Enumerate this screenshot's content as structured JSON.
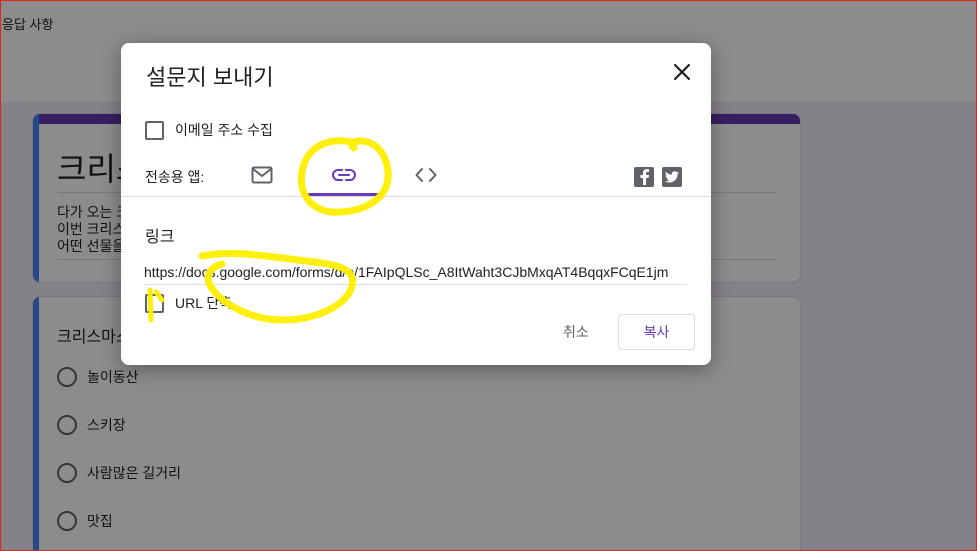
{
  "background": {
    "top_tab": "응답 사항",
    "form_title": "크리스마스",
    "description_lines": [
      "다가 오는 크리스마스",
      "이번 크리스마스에는",
      "어떤 선물을"
    ],
    "question_title": "크리스마스에",
    "options": [
      "놀이동산",
      "스키장",
      "사람많은 길거리",
      "맛집"
    ]
  },
  "dialog": {
    "title": "설문지 보내기",
    "collect_email_label": "이메일 주소 수집",
    "collect_email_checked": false,
    "send_via_label": "전송용 앱:",
    "tabs": [
      {
        "icon": "mail-icon",
        "active": false
      },
      {
        "icon": "link-icon",
        "active": true
      },
      {
        "icon": "embed-code-icon",
        "active": false
      }
    ],
    "social": [
      "facebook-icon",
      "twitter-icon"
    ],
    "link_section_label": "링크",
    "link_url": "https://docs.google.com/forms/d/e/1FAIpQLSc_A8ItWaht3CJbMxqAT4BqqxFCqE1jm",
    "shorten_label": "URL 단축",
    "shorten_checked": false,
    "cancel_label": "취소",
    "copy_label": "복사"
  },
  "colors": {
    "accent": "#673ab7",
    "annotation": "#ffee00",
    "frame": "#e0261d"
  }
}
